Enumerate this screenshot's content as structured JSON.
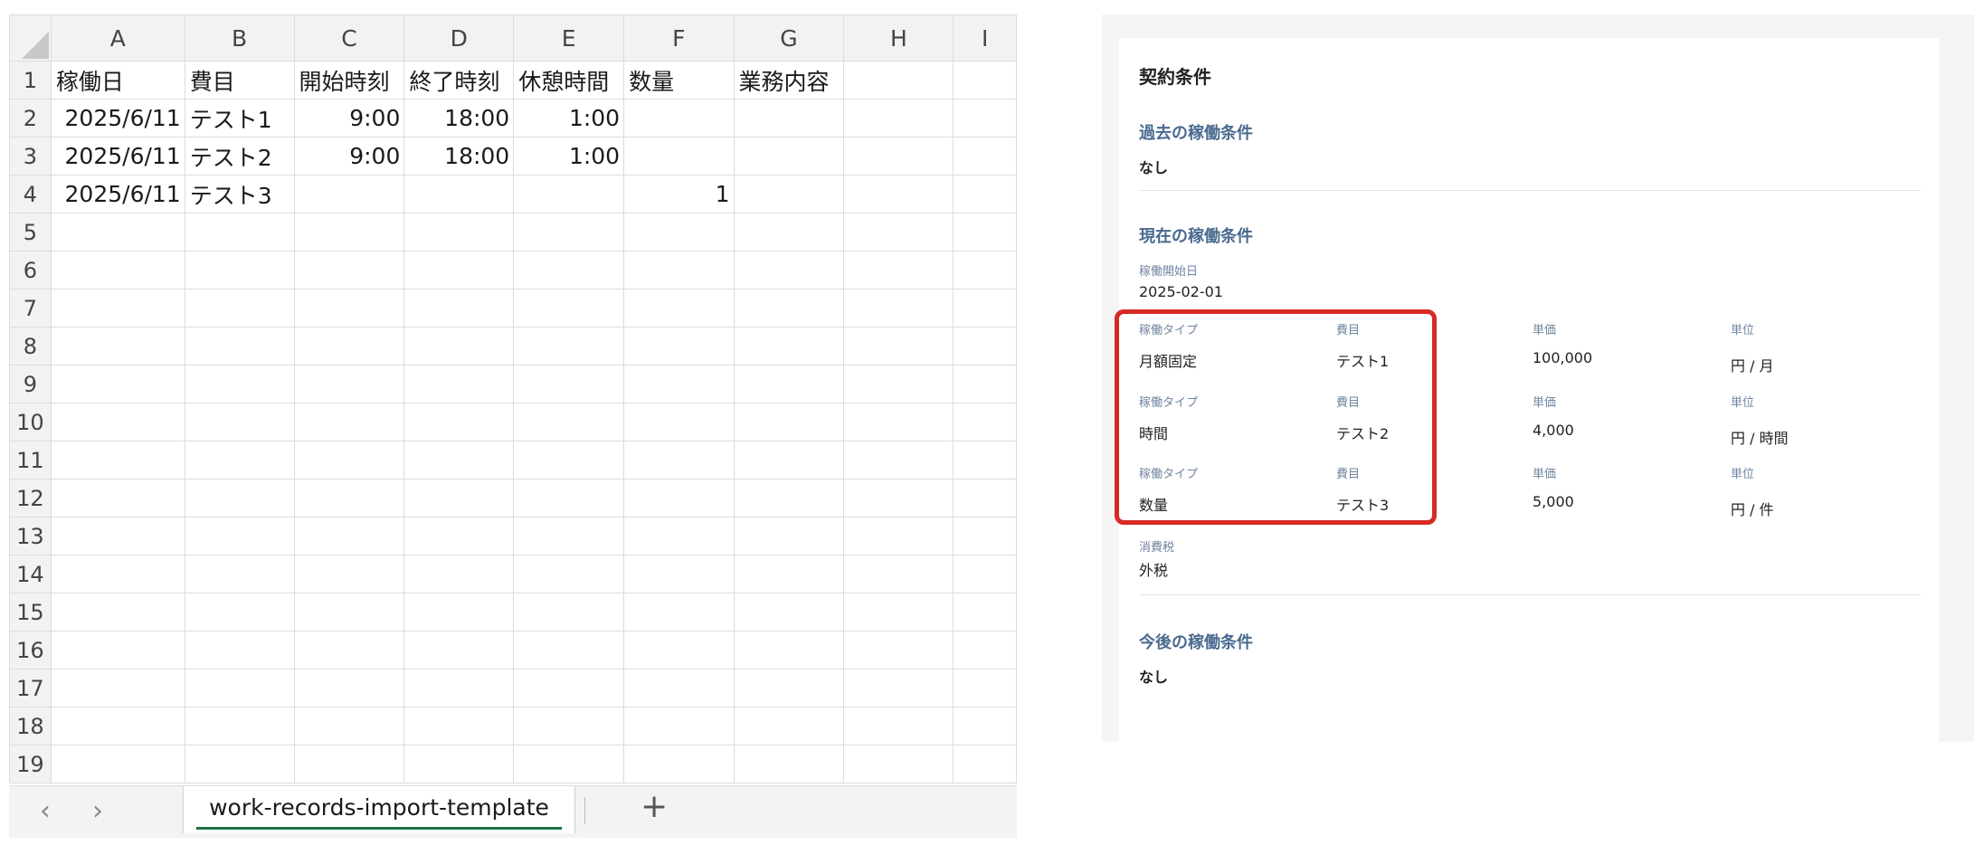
{
  "spreadsheet": {
    "columns": [
      "A",
      "B",
      "C",
      "D",
      "E",
      "F",
      "G",
      "H",
      "I"
    ],
    "rows": [
      {
        "num": "1",
        "cells": [
          "稼働日",
          "費目",
          "開始時刻",
          "終了時刻",
          "休憩時間",
          "数量",
          "業務内容",
          "",
          ""
        ]
      },
      {
        "num": "2",
        "cells": [
          "2025/6/11",
          "テスト1",
          "9:00",
          "18:00",
          "1:00",
          "",
          "",
          "",
          ""
        ]
      },
      {
        "num": "3",
        "cells": [
          "2025/6/11",
          "テスト2",
          "9:00",
          "18:00",
          "1:00",
          "",
          "",
          "",
          ""
        ]
      },
      {
        "num": "4",
        "cells": [
          "2025/6/11",
          "テスト3",
          "",
          "",
          "",
          "1",
          "",
          "",
          ""
        ]
      },
      {
        "num": "5",
        "cells": [
          "",
          "",
          "",
          "",
          "",
          "",
          "",
          "",
          ""
        ]
      },
      {
        "num": "6",
        "cells": [
          "",
          "",
          "",
          "",
          "",
          "",
          "",
          "",
          ""
        ]
      },
      {
        "num": "7",
        "cells": [
          "",
          "",
          "",
          "",
          "",
          "",
          "",
          "",
          ""
        ]
      },
      {
        "num": "8",
        "cells": [
          "",
          "",
          "",
          "",
          "",
          "",
          "",
          "",
          ""
        ]
      },
      {
        "num": "9",
        "cells": [
          "",
          "",
          "",
          "",
          "",
          "",
          "",
          "",
          ""
        ]
      },
      {
        "num": "10",
        "cells": [
          "",
          "",
          "",
          "",
          "",
          "",
          "",
          "",
          ""
        ]
      },
      {
        "num": "11",
        "cells": [
          "",
          "",
          "",
          "",
          "",
          "",
          "",
          "",
          ""
        ]
      },
      {
        "num": "12",
        "cells": [
          "",
          "",
          "",
          "",
          "",
          "",
          "",
          "",
          ""
        ]
      },
      {
        "num": "13",
        "cells": [
          "",
          "",
          "",
          "",
          "",
          "",
          "",
          "",
          ""
        ]
      },
      {
        "num": "14",
        "cells": [
          "",
          "",
          "",
          "",
          "",
          "",
          "",
          "",
          ""
        ]
      },
      {
        "num": "15",
        "cells": [
          "",
          "",
          "",
          "",
          "",
          "",
          "",
          "",
          ""
        ]
      },
      {
        "num": "16",
        "cells": [
          "",
          "",
          "",
          "",
          "",
          "",
          "",
          "",
          ""
        ]
      },
      {
        "num": "17",
        "cells": [
          "",
          "",
          "",
          "",
          "",
          "",
          "",
          "",
          ""
        ]
      },
      {
        "num": "18",
        "cells": [
          "",
          "",
          "",
          "",
          "",
          "",
          "",
          "",
          ""
        ]
      },
      {
        "num": "19",
        "cells": [
          "",
          "",
          "",
          "",
          "",
          "",
          "",
          "",
          ""
        ]
      }
    ],
    "tabbar": {
      "prev_icon": "‹",
      "next_icon": "›",
      "active_sheet": "work-records-import-template",
      "add_icon": "+"
    }
  },
  "contract": {
    "title": "契約条件",
    "past": {
      "title": "過去の稼働条件",
      "value": "なし"
    },
    "current": {
      "title": "現在の稼働条件",
      "start_label": "稼働開始日",
      "start_value": "2025-02-01",
      "rows": [
        {
          "type_label": "稼働タイプ",
          "type": "月額固定",
          "item_label": "費目",
          "item": "テスト1",
          "price_label": "単価",
          "price": "100,000",
          "unit_label": "単位",
          "unit": "円 / 月"
        },
        {
          "type_label": "稼働タイプ",
          "type": "時間",
          "item_label": "費目",
          "item": "テスト2",
          "price_label": "単価",
          "price": "4,000",
          "unit_label": "単位",
          "unit": "円 / 時間"
        },
        {
          "type_label": "稼働タイプ",
          "type": "数量",
          "item_label": "費目",
          "item": "テスト3",
          "price_label": "単価",
          "price": "5,000",
          "unit_label": "単位",
          "unit": "円 / 件"
        }
      ],
      "tax_label": "消費税",
      "tax_value": "外税"
    },
    "future": {
      "title": "今後の稼働条件",
      "value": "なし"
    }
  },
  "colors": {
    "highlight": "#d62a24",
    "section_title": "#4a6a8f",
    "sheet_tab_accent": "#1e7145"
  }
}
